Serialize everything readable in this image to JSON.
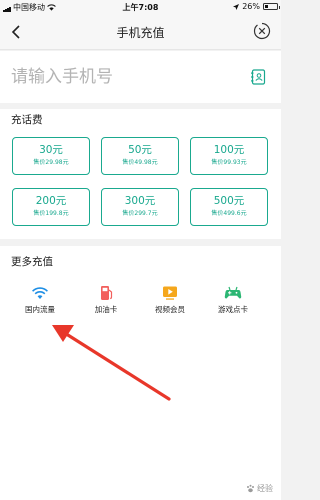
{
  "status_bar": {
    "carrier": "中国移动",
    "time": "上午7:08",
    "battery": "26%"
  },
  "nav": {
    "title": "手机充值"
  },
  "phone": {
    "placeholder": "请输入手机号"
  },
  "recharge": {
    "title": "充话费",
    "options": [
      {
        "amount": "30元",
        "price": "售价29.98元"
      },
      {
        "amount": "50元",
        "price": "售价49.98元"
      },
      {
        "amount": "100元",
        "price": "售价99.93元"
      },
      {
        "amount": "200元",
        "price": "售价199.8元"
      },
      {
        "amount": "300元",
        "price": "售价299.7元"
      },
      {
        "amount": "500元",
        "price": "售价499.6元"
      }
    ]
  },
  "more": {
    "title": "更多充值",
    "items": [
      {
        "label": "国内流量",
        "icon": "wifi-icon"
      },
      {
        "label": "加油卡",
        "icon": "fuel-pump-icon"
      },
      {
        "label": "视频会员",
        "icon": "video-play-icon"
      },
      {
        "label": "游戏点卡",
        "icon": "gamepad-icon"
      }
    ]
  },
  "watermark": {
    "text": "经验"
  },
  "colors": {
    "accent": "#18a88e",
    "annotation_arrow": "#e8372a"
  }
}
